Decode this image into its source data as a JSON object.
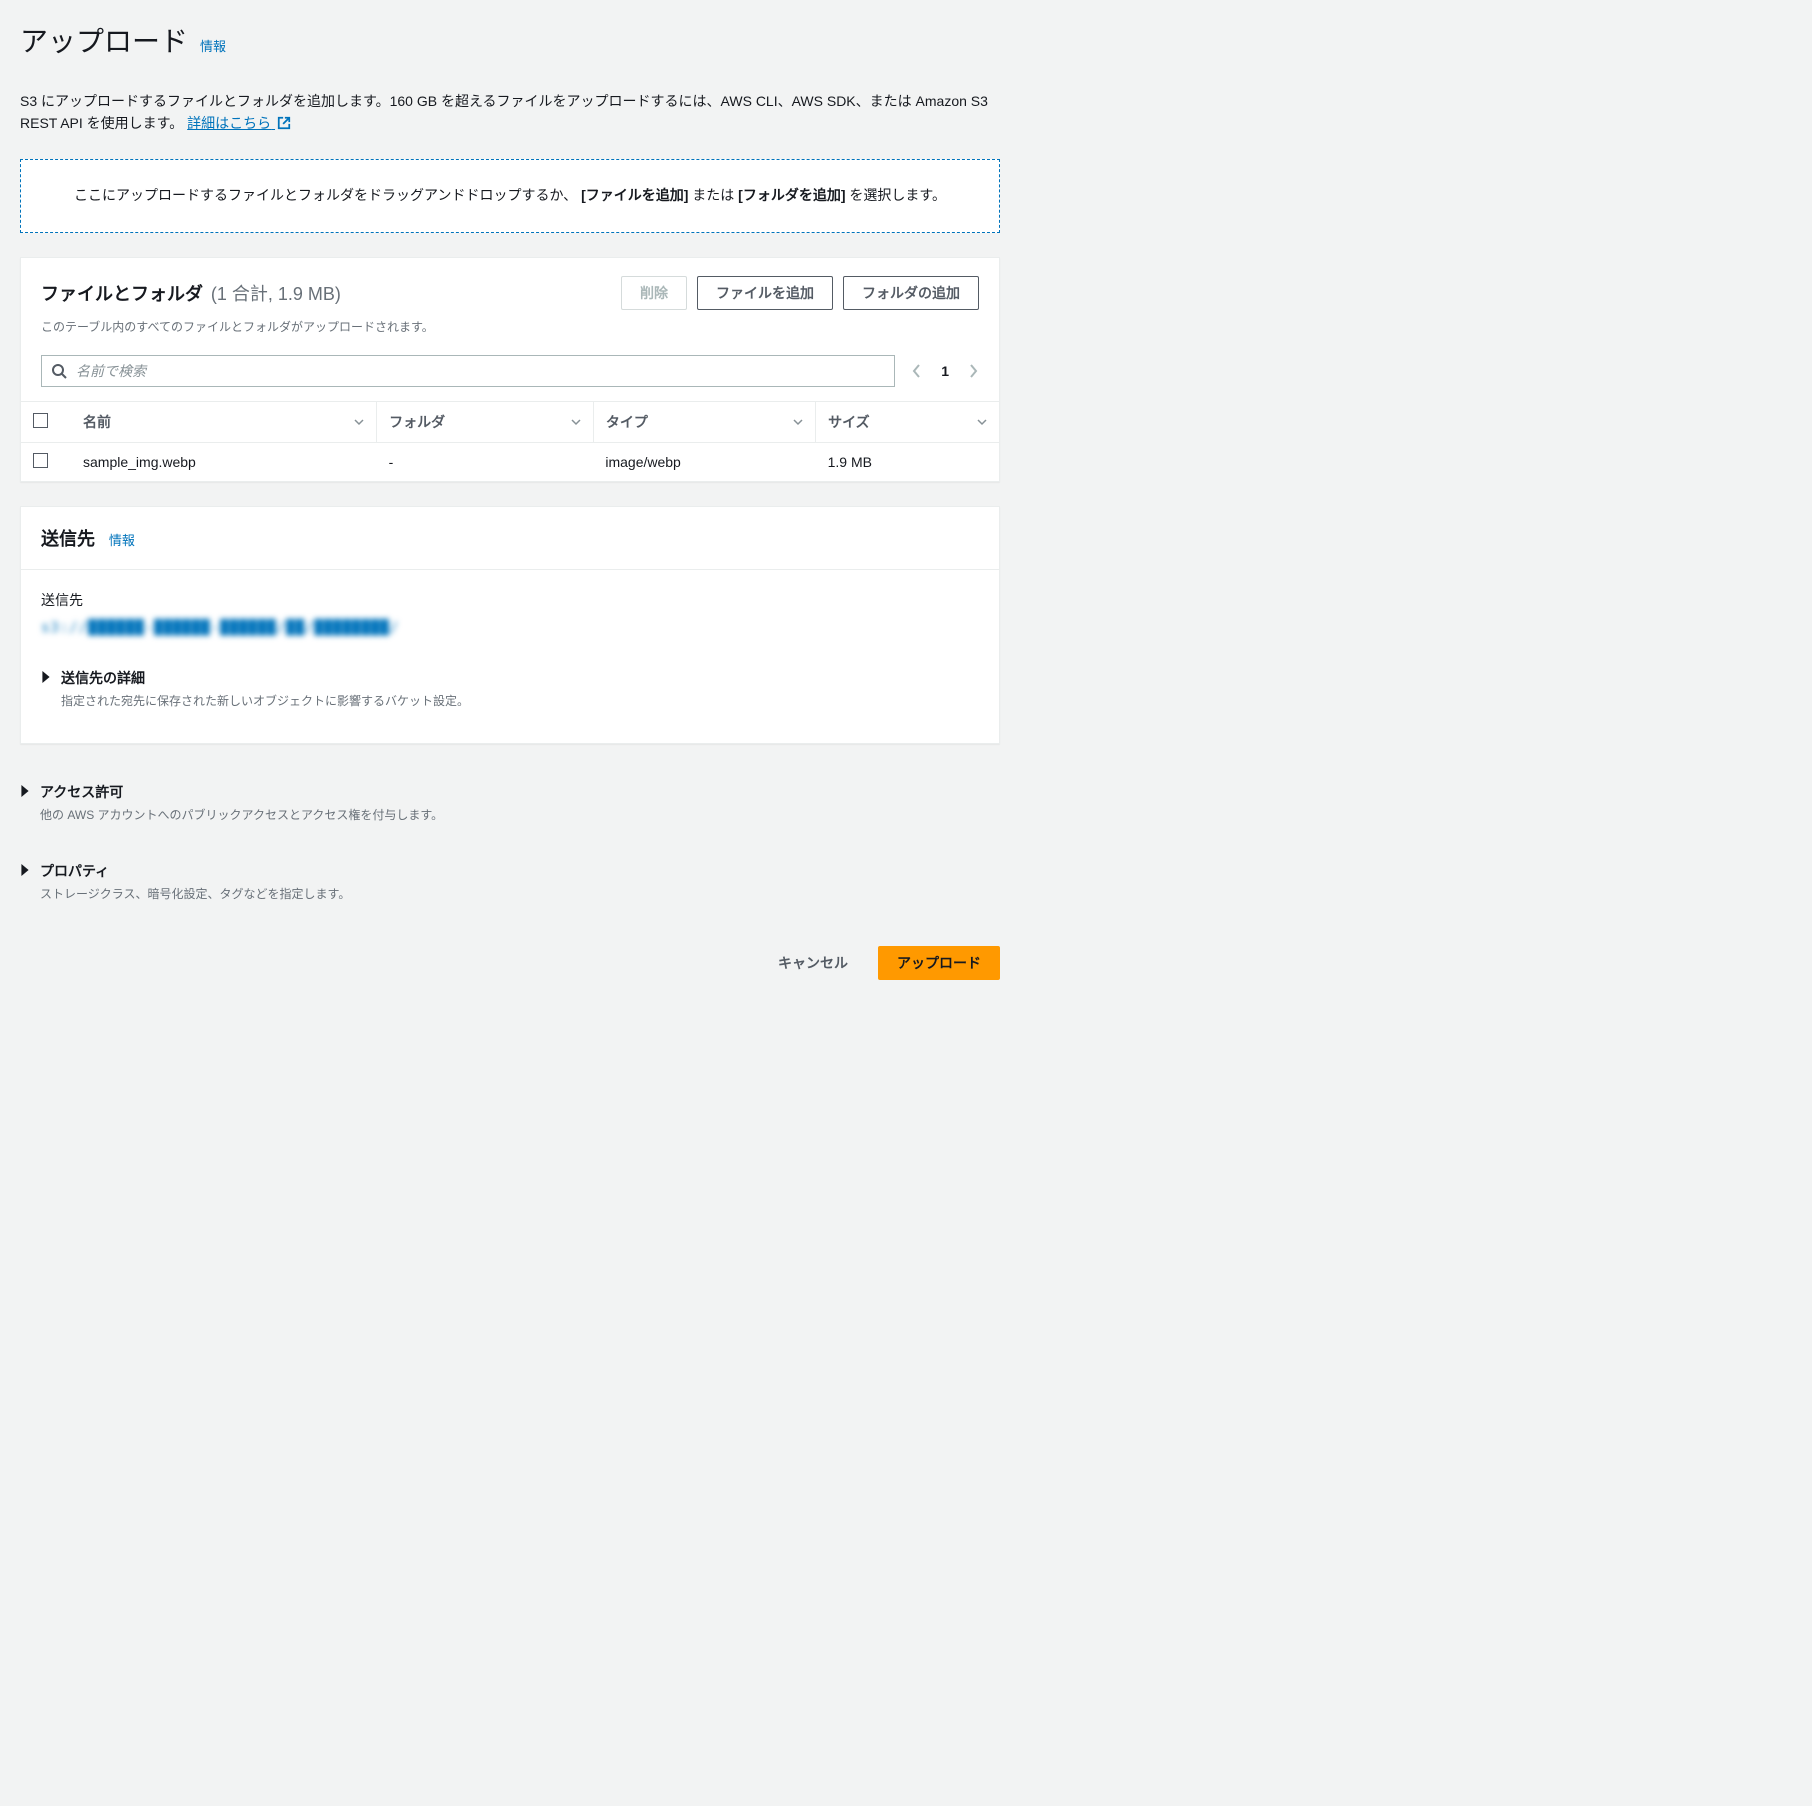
{
  "header": {
    "title": "アップロード",
    "info_label": "情報"
  },
  "intro": {
    "text": "S3 にアップロードするファイルとフォルダを追加します。160 GB を超えるファイルをアップロードするには、AWS CLI、AWS SDK、または Amazon S3 REST API を使用します。",
    "learn_more": "詳細はこちら"
  },
  "dropzone": {
    "prefix": "ここにアップロードするファイルとフォルダをドラッグアンドドロップするか、",
    "add_file_bold": "[ファイルを追加]",
    "middle": " または ",
    "add_folder_bold": "[フォルダを追加]",
    "suffix": " を選択します。"
  },
  "files_panel": {
    "title": "ファイルとフォルダ",
    "count_summary": "(1 合計, 1.9 MB)",
    "desc": "このテーブル内のすべてのファイルとフォルダがアップロードされます。",
    "btn_delete": "削除",
    "btn_add_file": "ファイルを追加",
    "btn_add_folder": "フォルダの追加",
    "search_placeholder": "名前で検索",
    "page_number": "1",
    "columns": {
      "name": "名前",
      "folder": "フォルダ",
      "type": "タイプ",
      "size": "サイズ"
    },
    "rows": [
      {
        "name": "sample_img.webp",
        "folder": "-",
        "type": "image/webp",
        "size": "1.9 MB"
      }
    ]
  },
  "destination_panel": {
    "title": "送信先",
    "info_label": "情報",
    "label": "送信先",
    "value_redacted": "s3://██████-██████-██████/██/████████/",
    "details_title": "送信先の詳細",
    "details_desc": "指定された宛先に保存された新しいオブジェクトに影響するバケット設定。"
  },
  "permissions": {
    "title": "アクセス許可",
    "desc": "他の AWS アカウントへのパブリックアクセスとアクセス権を付与します。"
  },
  "properties": {
    "title": "プロパティ",
    "desc": "ストレージクラス、暗号化設定、タグなどを指定します。"
  },
  "footer": {
    "cancel": "キャンセル",
    "upload": "アップロード"
  }
}
